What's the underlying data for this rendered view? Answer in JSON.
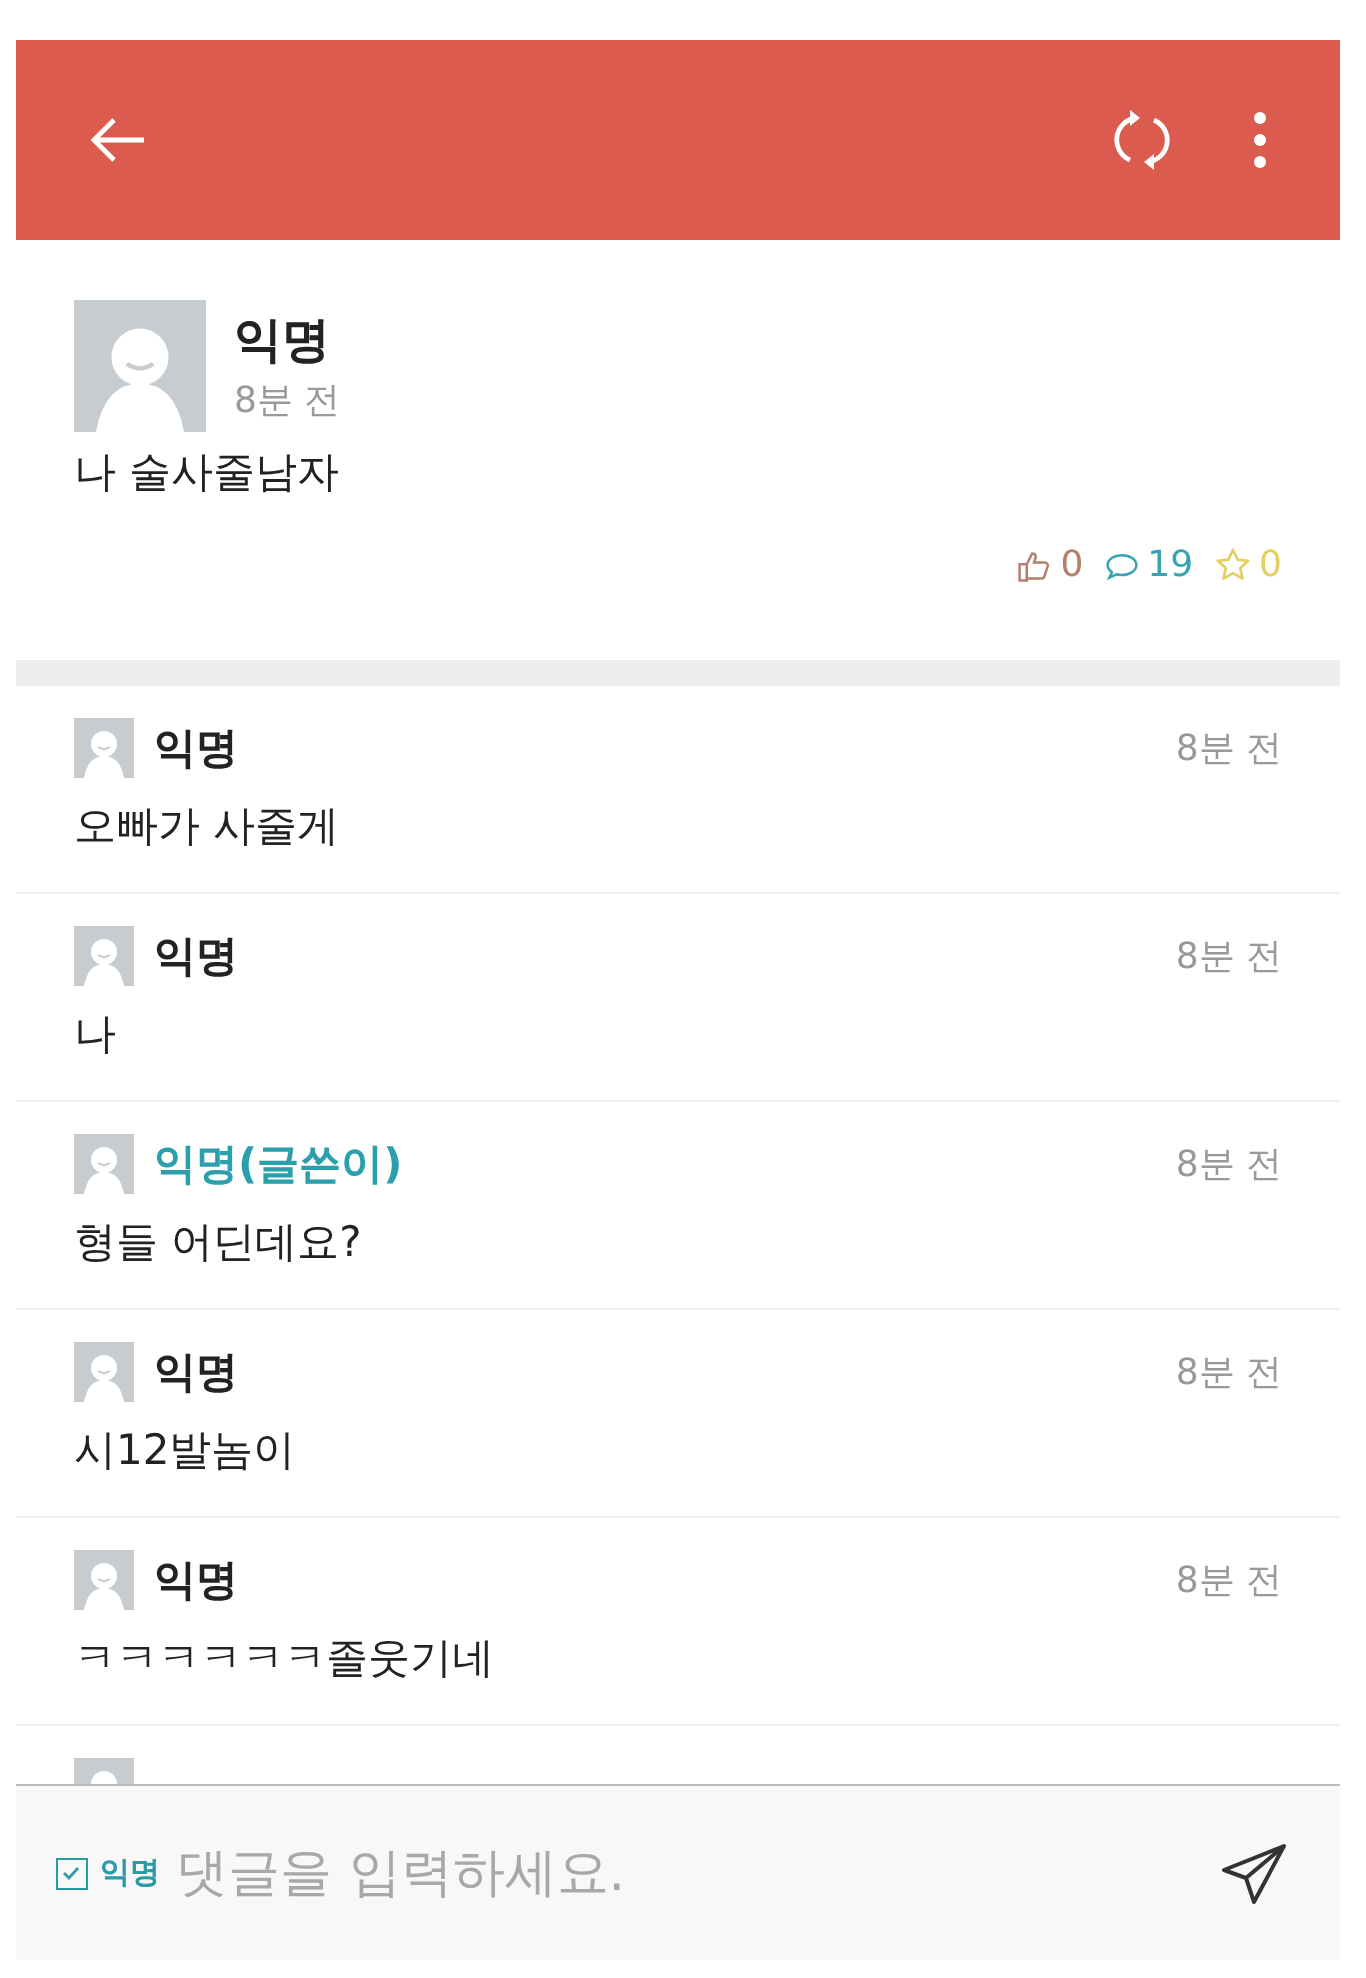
{
  "post": {
    "author": "익명",
    "time": "8분 전",
    "body": "나 술사줄남자",
    "counters": [
      {
        "kind": "like",
        "value": "0"
      },
      {
        "kind": "comment",
        "value": "19"
      },
      {
        "kind": "star",
        "value": "0"
      }
    ]
  },
  "comments": [
    {
      "kind": "normal",
      "author": "익명",
      "time": "8분 전",
      "text": "오빠가 사줄게"
    },
    {
      "kind": "normal",
      "author": "익명",
      "time": "8분 전",
      "text": "나"
    },
    {
      "kind": "author",
      "author": "익명(글쓴이)",
      "time": "8분 전",
      "text": "형들 어딘데요?"
    },
    {
      "kind": "normal",
      "author": "익명",
      "time": "8분 전",
      "text": "시12발놈이"
    },
    {
      "kind": "normal",
      "author": "익명",
      "time": "8분 전",
      "text": "ㅋㅋㅋㅋㅋㅋ졸웃기네"
    }
  ],
  "composer": {
    "anonymous": {
      "label": "익명",
      "checked": true
    },
    "placeholder": "댓글을 입력하세요."
  }
}
